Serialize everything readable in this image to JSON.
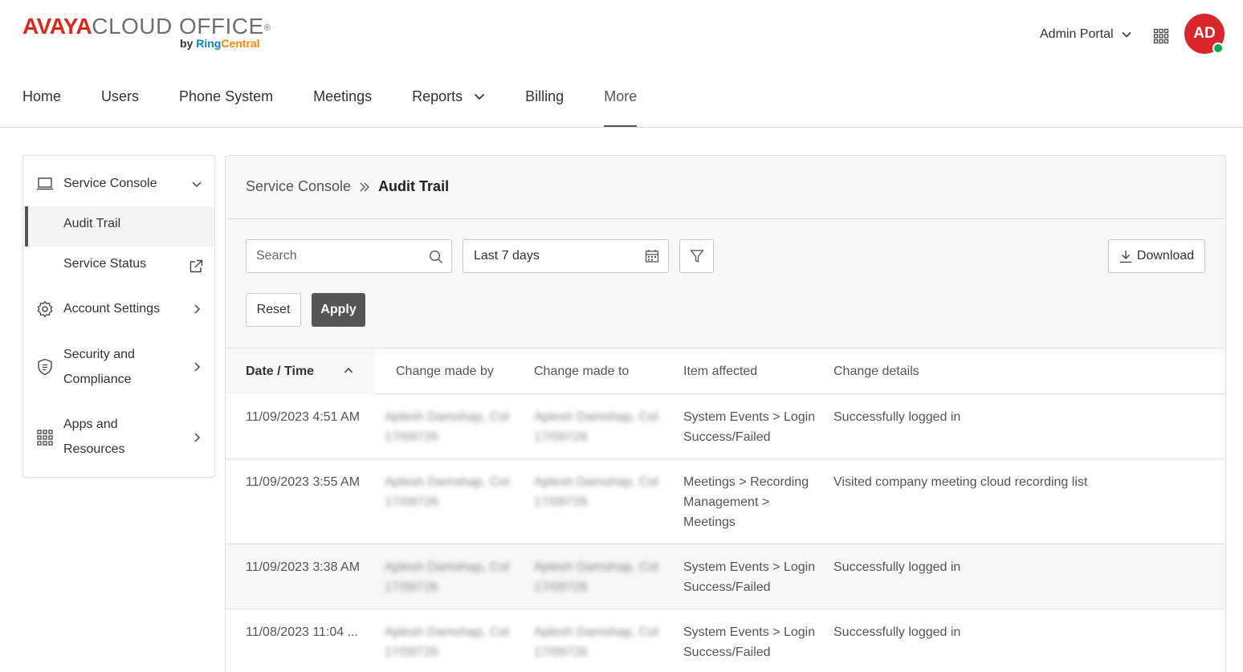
{
  "logo": {
    "avaya": "AVAYA",
    "cloud_office": "CLOUD OFFICE",
    "reg": "®",
    "by": "by",
    "ring": "Ring",
    "central": "Central"
  },
  "header": {
    "admin_portal": "Admin Portal",
    "avatar_initials": "AD",
    "colors": {
      "avatar": "#d9262b",
      "status": "#06a84f",
      "brand_red": "#da291c"
    }
  },
  "nav": {
    "items": [
      {
        "label": "Home"
      },
      {
        "label": "Users"
      },
      {
        "label": "Phone System"
      },
      {
        "label": "Meetings"
      },
      {
        "label": "Reports"
      },
      {
        "label": "Billing"
      },
      {
        "label": "More"
      }
    ]
  },
  "sidebar": {
    "service_console": "Service Console",
    "audit_trail": "Audit Trail",
    "service_status": "Service Status",
    "account_settings": "Account Settings",
    "security_line1": "Security and",
    "security_line2": "Compliance",
    "apps_line1": "Apps and",
    "apps_line2": "Resources"
  },
  "breadcrumb": {
    "parent": "Service Console",
    "current": "Audit Trail"
  },
  "toolbar": {
    "search_placeholder": "Search",
    "date_range": "Last 7 days",
    "download": "Download",
    "reset": "Reset",
    "apply": "Apply"
  },
  "table": {
    "columns": [
      "Date / Time",
      "Change made by",
      "Change made to",
      "Item affected",
      "Change details"
    ],
    "rows": [
      {
        "date": "11/09/2023 4:51 AM",
        "by": "Aplesh Damshap, Col 17/09726",
        "to": "Aplesh Damshap, Col 17/09726",
        "item": "System Events > Login Success/Failed",
        "detail": "Successfully logged in"
      },
      {
        "date": "11/09/2023 3:55 AM",
        "by": "Aplesh Damshap, Col 17/09726",
        "to": "Aplesh Damshap, Col 17/09726",
        "item": "Meetings > Recording Management > Meetings",
        "detail": "Visited company meeting cloud recording list"
      },
      {
        "date": "11/09/2023 3:38 AM",
        "by": "Aplesh Damshap, Col 17/09726",
        "to": "Aplesh Damshap, Col 17/09726",
        "item": "System Events > Login Success/Failed",
        "detail": "Successfully logged in"
      },
      {
        "date": "11/08/2023 11:04 ...",
        "by": "Aplesh Damshap, Col 17/09726",
        "to": "Aplesh Damshap, Col 17/09726",
        "item": "System Events > Login Success/Failed",
        "detail": "Successfully logged in"
      }
    ]
  }
}
